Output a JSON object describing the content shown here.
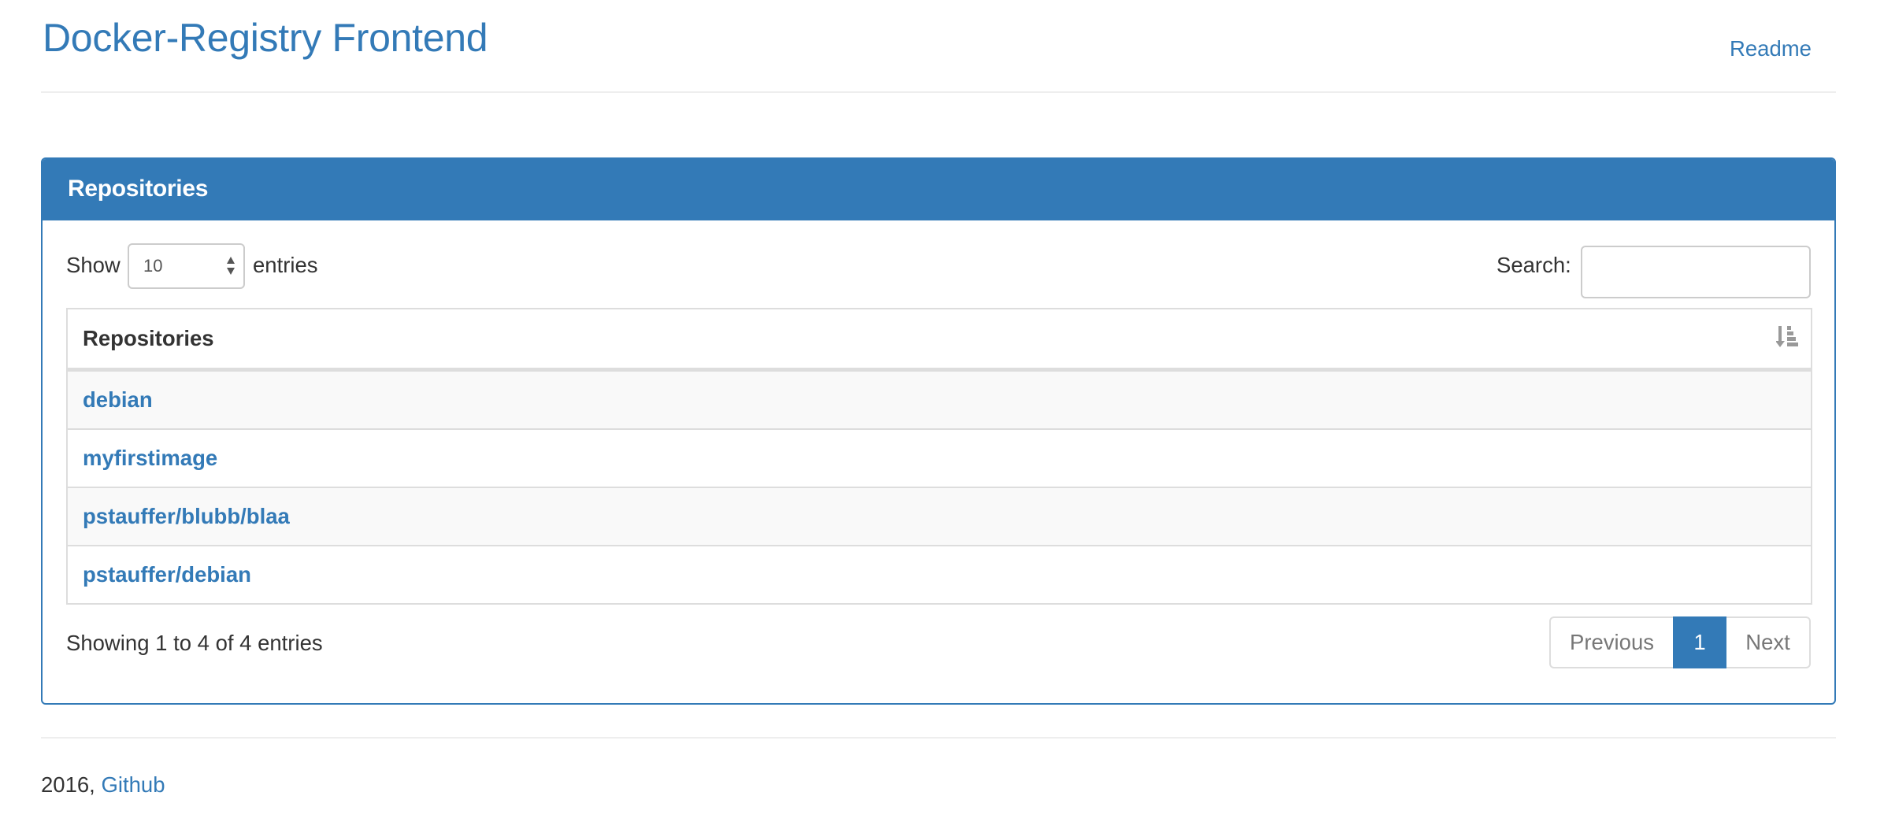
{
  "header": {
    "title": "Docker-Registry Frontend",
    "readme_link": "Readme"
  },
  "panel": {
    "title": "Repositories",
    "length": {
      "show_label": "Show",
      "selected": "10",
      "entries_label": "entries"
    },
    "search": {
      "label": "Search:",
      "value": "",
      "placeholder": ""
    },
    "table": {
      "columns": [
        "Repositories"
      ],
      "sort": "ascending",
      "rows": [
        {
          "name": "debian"
        },
        {
          "name": "myfirstimage"
        },
        {
          "name": "pstauffer/blubb/blaa"
        },
        {
          "name": "pstauffer/debian"
        }
      ]
    },
    "info": "Showing 1 to 4 of 4 entries",
    "pagination": {
      "previous": "Previous",
      "current_page": "1",
      "next": "Next"
    }
  },
  "footer": {
    "year": "2016,",
    "link": "Github"
  },
  "colors": {
    "brand": "#337ab7",
    "muted": "#777777",
    "border": "#dddddd",
    "stripe": "#f9f9f9"
  },
  "icons": {
    "sort": "sort-by-attributes-icon",
    "select_arrows": "select-updown-icon"
  }
}
